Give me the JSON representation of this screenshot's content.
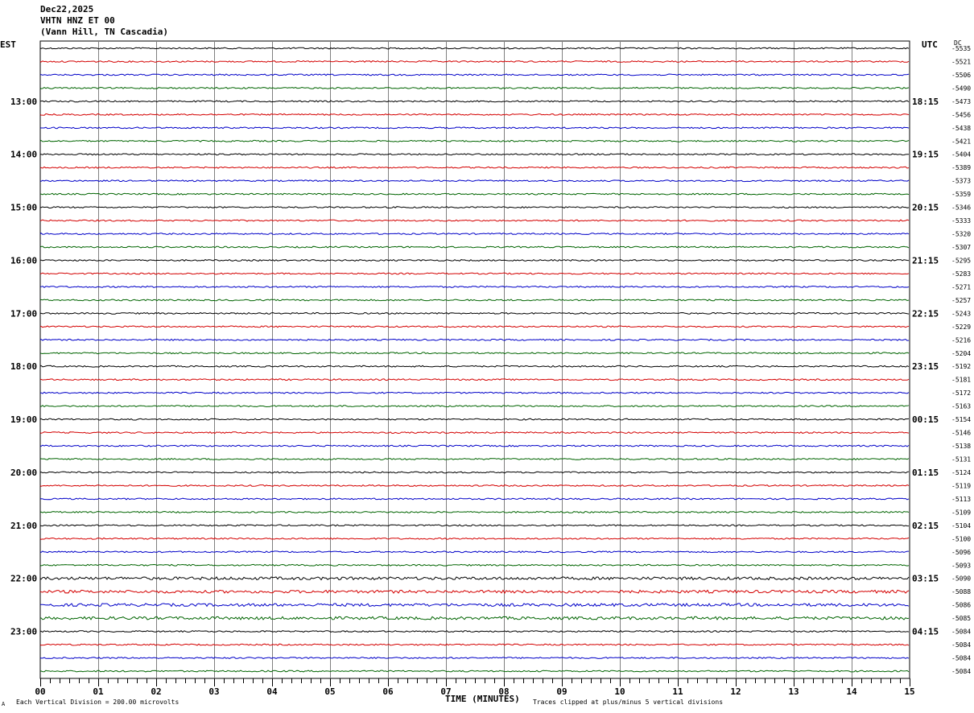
{
  "header": {
    "date": "Dec22,2025",
    "channel": "VHTN HNZ ET 00",
    "station": "(Vann Hill, TN Cascadia)"
  },
  "chart_data": {
    "type": "helicorder",
    "left_timezone": "EST",
    "right_timezone": "UTC",
    "dc_label": "DC",
    "left_hour_labels": [
      "13:00",
      "14:00",
      "15:00",
      "16:00",
      "17:00",
      "18:00",
      "19:00",
      "20:00",
      "21:00",
      "22:00",
      "23:00"
    ],
    "right_hour_labels": [
      "18:15",
      "19:15",
      "20:15",
      "21:15",
      "22:15",
      "23:15",
      "00:15",
      "01:15",
      "02:15",
      "03:15",
      "04:15"
    ],
    "x_ticks": [
      "00",
      "01",
      "02",
      "03",
      "04",
      "05",
      "06",
      "07",
      "08",
      "09",
      "10",
      "11",
      "12",
      "13",
      "14",
      "15"
    ],
    "xlabel": "TIME (MINUTES)",
    "dc_offsets": [
      "-5535",
      "-5521",
      "-5506",
      "-5490",
      "-5473",
      "-5456",
      "-5438",
      "-5421",
      "-5404",
      "-5389",
      "-5373",
      "-5359",
      "-5346",
      "-5333",
      "-5320",
      "-5307",
      "-5295",
      "-5283",
      "-5271",
      "-5257",
      "-5243",
      "-5229",
      "-5216",
      "-5204",
      "-5192",
      "-5181",
      "-5172",
      "-5163",
      "-5154",
      "-5146",
      "-5138",
      "-5131",
      "-5124",
      "-5119",
      "-5113",
      "-5109",
      "-5104",
      "-5100",
      "-5096",
      "-5093",
      "-5090",
      "-5088",
      "-5086",
      "-5085",
      "-5084",
      "-5084",
      "-5084",
      "-5084"
    ],
    "trace_colors": [
      "#000000",
      "#d40000",
      "#0000c8",
      "#006400"
    ],
    "grid_color": "#808080",
    "footer_left": "Each Vertical Division =  200.00 microvolts",
    "footer_right": "Traces clipped at plus/minus 5 vertical divisions",
    "corner_mark": "A"
  }
}
